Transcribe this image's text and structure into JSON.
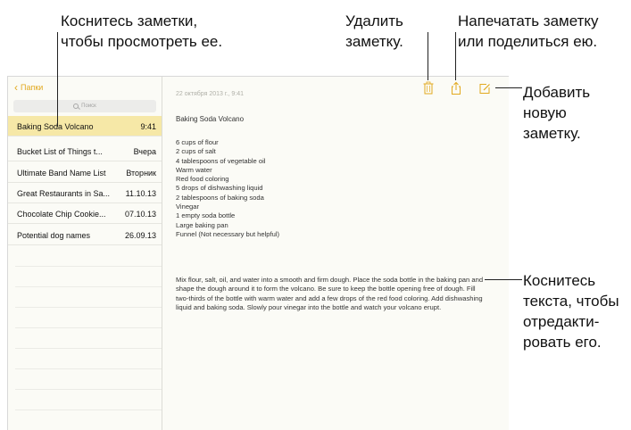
{
  "callouts": {
    "tap_note": [
      "Коснитесь заметки,",
      "чтобы просмотреть ее."
    ],
    "delete_note": [
      "Удалить",
      "заметку."
    ],
    "print_share": [
      "Напечатать заметку",
      "или поделиться ею."
    ],
    "add_note": [
      "Добавить",
      "новую",
      "заметку."
    ],
    "tap_text": [
      "Коснитесь",
      "текста, чтобы",
      "отредакти-",
      "ровать его."
    ]
  },
  "sidebar": {
    "back_label": "Папки",
    "search_placeholder": "Поиск",
    "notes": [
      {
        "title": "Baking Soda Volcano",
        "date": "9:41",
        "selected": true
      },
      {
        "title": "Bucket List of Things t...",
        "date": "Вчера",
        "selected": false
      },
      {
        "title": "Ultimate Band Name List",
        "date": "Вторник",
        "selected": false
      },
      {
        "title": "Great Restaurants in Sa...",
        "date": "11.10.13",
        "selected": false
      },
      {
        "title": "Chocolate Chip Cookie...",
        "date": "07.10.13",
        "selected": false
      },
      {
        "title": "Potential dog names",
        "date": "26.09.13",
        "selected": false
      }
    ]
  },
  "toolbar": {
    "trash_icon": "trash-icon",
    "share_icon": "share-icon",
    "compose_icon": "compose-icon",
    "accent": "#e2a91f"
  },
  "note": {
    "date": "22 октября 2013 г., 9:41",
    "title": "Baking Soda Volcano",
    "ingredients": [
      "6 cups of flour",
      "2 cups of salt",
      "4 tablespoons of vegetable oil",
      "Warm water",
      "Red food coloring",
      "5 drops of dishwashing liquid",
      "2 tablespoons of baking soda",
      "Vinegar",
      "1 empty soda bottle",
      "Large baking pan",
      "Funnel (Not necessary but helpful)"
    ],
    "instructions": "Mix flour, salt, oil, and water into a smooth and firm dough.  Place the soda bottle in the baking pan and shape the dough around it to form the volcano.  Be sure to keep the bottle opening free of dough.  Fill two-thirds of the bottle with warm water and add a few drops of the red food coloring. Add dishwashing liquid and baking soda. Slowly pour vinegar into the bottle and watch your volcano erupt."
  }
}
